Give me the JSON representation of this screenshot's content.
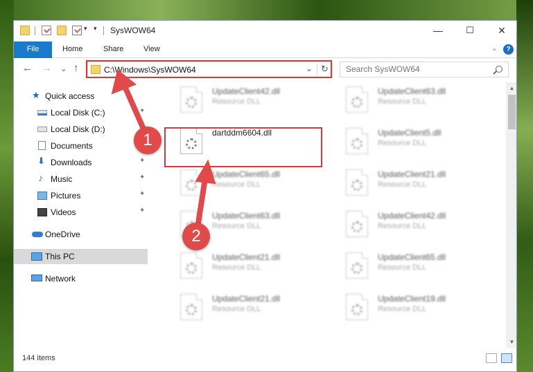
{
  "window": {
    "title": "SysWOW64",
    "minimize_glyph": "—",
    "maximize_glyph": "☐",
    "close_glyph": "✕"
  },
  "ribbon": {
    "tabs": [
      "File",
      "Home",
      "Share",
      "View"
    ],
    "help_glyph": "?",
    "collapse_glyph": "⌄"
  },
  "address": {
    "path": "C:\\Windows\\SysWOW64",
    "dropdown_glyph": "⌄",
    "refresh_glyph": "↻",
    "back_glyph": "←",
    "forward_glyph": "→",
    "recent_glyph": "⌄",
    "up_glyph": "↑"
  },
  "search": {
    "placeholder": "Search SysWOW64"
  },
  "sidebar": {
    "items": [
      {
        "label": "Quick access",
        "icon": "star-icon"
      },
      {
        "label": "Local Disk (C:)",
        "icon": "drive-icon"
      },
      {
        "label": "Local Disk (D:)",
        "icon": "drive-icon"
      },
      {
        "label": "Documents",
        "icon": "document-icon"
      },
      {
        "label": "Downloads",
        "icon": "download-icon"
      },
      {
        "label": "Music",
        "icon": "music-icon"
      },
      {
        "label": "Pictures",
        "icon": "pictures-icon"
      },
      {
        "label": "Videos",
        "icon": "videos-icon"
      },
      {
        "label": "OneDrive",
        "icon": "onedrive-icon"
      },
      {
        "label": "This PC",
        "icon": "pc-icon"
      },
      {
        "label": "Network",
        "icon": "network-icon"
      }
    ],
    "pin_glyph": "📌"
  },
  "files": [
    {
      "name": "UpdateClient42.dll",
      "type": "Resource DLL"
    },
    {
      "name": "UpdateClient63.dll",
      "type": "Resource DLL"
    },
    {
      "name": "dartddm6604.dll",
      "type": ""
    },
    {
      "name": "UpdateClient5.dll",
      "type": "Resource DLL"
    },
    {
      "name": "UpdateClient65.dll",
      "type": "Resource DLL"
    },
    {
      "name": "UpdateClient21.dll",
      "type": "Resource DLL"
    },
    {
      "name": "UpdateClient63.dll",
      "type": "Resource DLL"
    },
    {
      "name": "UpdateClient42.dll",
      "type": "Resource DLL"
    },
    {
      "name": "UpdateClient21.dll",
      "type": "Resource DLL"
    },
    {
      "name": "UpdateClient65.dll",
      "type": "Resource DLL"
    },
    {
      "name": "UpdateClient21.dll",
      "type": "Resource DLL"
    },
    {
      "name": "UpdateClient19.dll",
      "type": "Resource DLL"
    }
  ],
  "status": {
    "item_count": "144 items"
  },
  "annotations": {
    "step1": "1",
    "step2": "2",
    "color": "#e14a4a"
  },
  "colors": {
    "accent": "#1979ca",
    "highlight_border": "#d33a3a"
  }
}
